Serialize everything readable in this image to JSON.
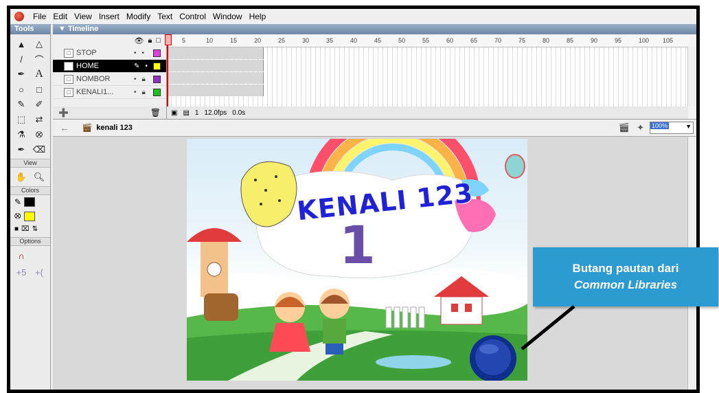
{
  "menu": [
    "File",
    "Edit",
    "View",
    "Insert",
    "Modify",
    "Text",
    "Control",
    "Window",
    "Help"
  ],
  "tools_panel": {
    "title": "Tools",
    "view_label": "View",
    "colors_label": "Colors",
    "options_label": "Options"
  },
  "timeline": {
    "title": "Timeline",
    "ruler": [
      "5",
      "10",
      "15",
      "20",
      "25",
      "30",
      "35",
      "40",
      "45",
      "50",
      "55",
      "60",
      "65",
      "70",
      "75",
      "80",
      "85",
      "90",
      "95",
      "100",
      "105"
    ],
    "layers": [
      {
        "name": "STOP",
        "color": "#e040e0"
      },
      {
        "name": "HOME",
        "color": "#ffff00",
        "selected": true
      },
      {
        "name": "NOMBOR",
        "color": "#9030c0"
      },
      {
        "name": "KENALI1...",
        "color": "#20c020"
      }
    ],
    "status": {
      "frame": "1",
      "fps": "12.0fps",
      "time": "0.0s"
    }
  },
  "editbar": {
    "scene_name": "kenali 123",
    "zoom": "100%"
  },
  "stage": {
    "title_text": "KENALI 123",
    "numeral": "1"
  },
  "callout": {
    "line1": "Butang pautan dari",
    "line2": "Common Libraries"
  }
}
